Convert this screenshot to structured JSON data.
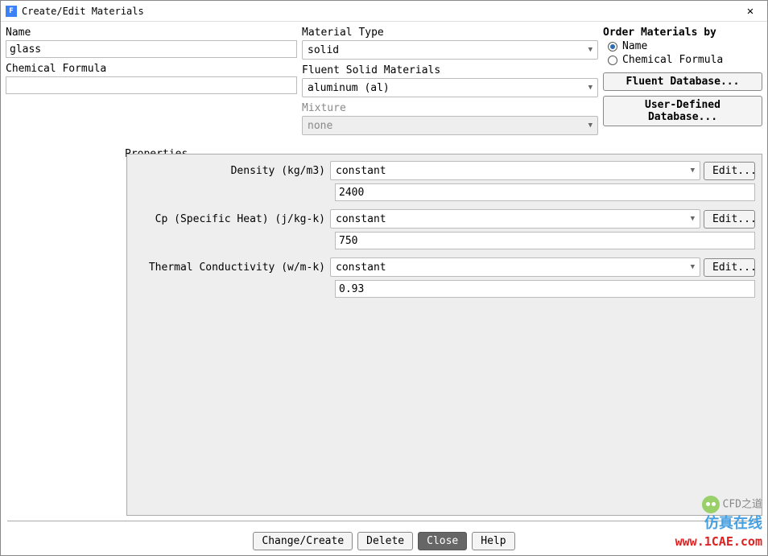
{
  "window": {
    "title": "Create/Edit Materials"
  },
  "left": {
    "name_label": "Name",
    "name_value": "glass",
    "formula_label": "Chemical Formula",
    "formula_value": ""
  },
  "mid": {
    "type_label": "Material Type",
    "type_value": "solid",
    "solid_label": "Fluent Solid Materials",
    "solid_value": "aluminum (al)",
    "mixture_label": "Mixture",
    "mixture_value": "none"
  },
  "right": {
    "order_label": "Order Materials by",
    "radio_name": "Name",
    "radio_formula": "Chemical Formula",
    "btn_fluent": "Fluent Database...",
    "btn_user": "User-Defined Database..."
  },
  "props": {
    "legend": "Properties",
    "edit": "Edit...",
    "rows": [
      {
        "label": "Density (kg/m3)",
        "method": "constant",
        "value": "2400"
      },
      {
        "label": "Cp (Specific Heat) (j/kg-k)",
        "method": "constant",
        "value": "750"
      },
      {
        "label": "Thermal Conductivity (w/m-k)",
        "method": "constant",
        "value": "0.93"
      }
    ]
  },
  "footer": {
    "change": "Change/Create",
    "delete": "Delete",
    "close": "Close",
    "help": "Help"
  },
  "watermark": {
    "cfd": "CFD之道",
    "cn": "仿真在线",
    "url": "www.1CAE.com"
  }
}
